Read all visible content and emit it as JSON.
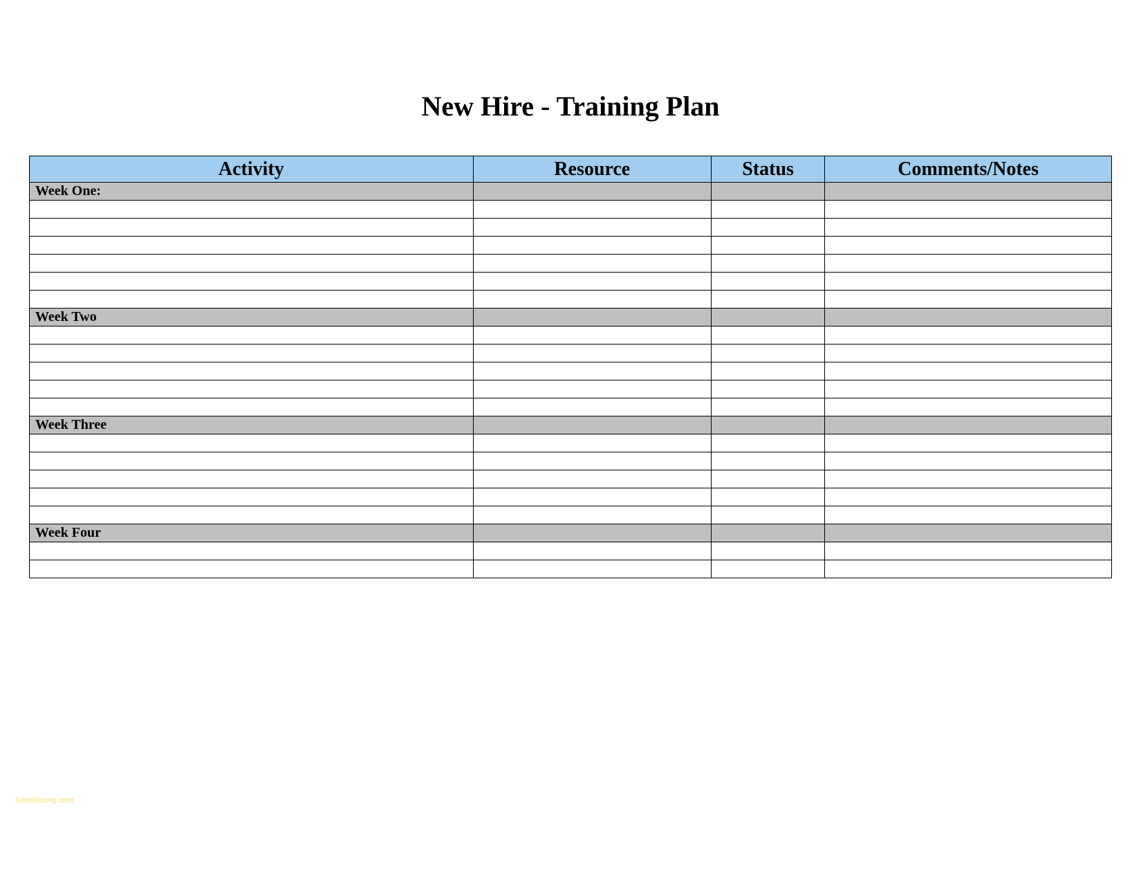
{
  "title": "New Hire - Training Plan",
  "columns": {
    "activity": "Activity",
    "resource": "Resource",
    "status": "Status",
    "comments": "Comments/Notes"
  },
  "sections": [
    {
      "label": "Week One:",
      "blank_rows": 6
    },
    {
      "label": "Week Two",
      "blank_rows": 5
    },
    {
      "label": "Week Three",
      "blank_rows": 5
    },
    {
      "label": "Week Four",
      "blank_rows": 2
    }
  ],
  "watermark": "Gembloong.com"
}
